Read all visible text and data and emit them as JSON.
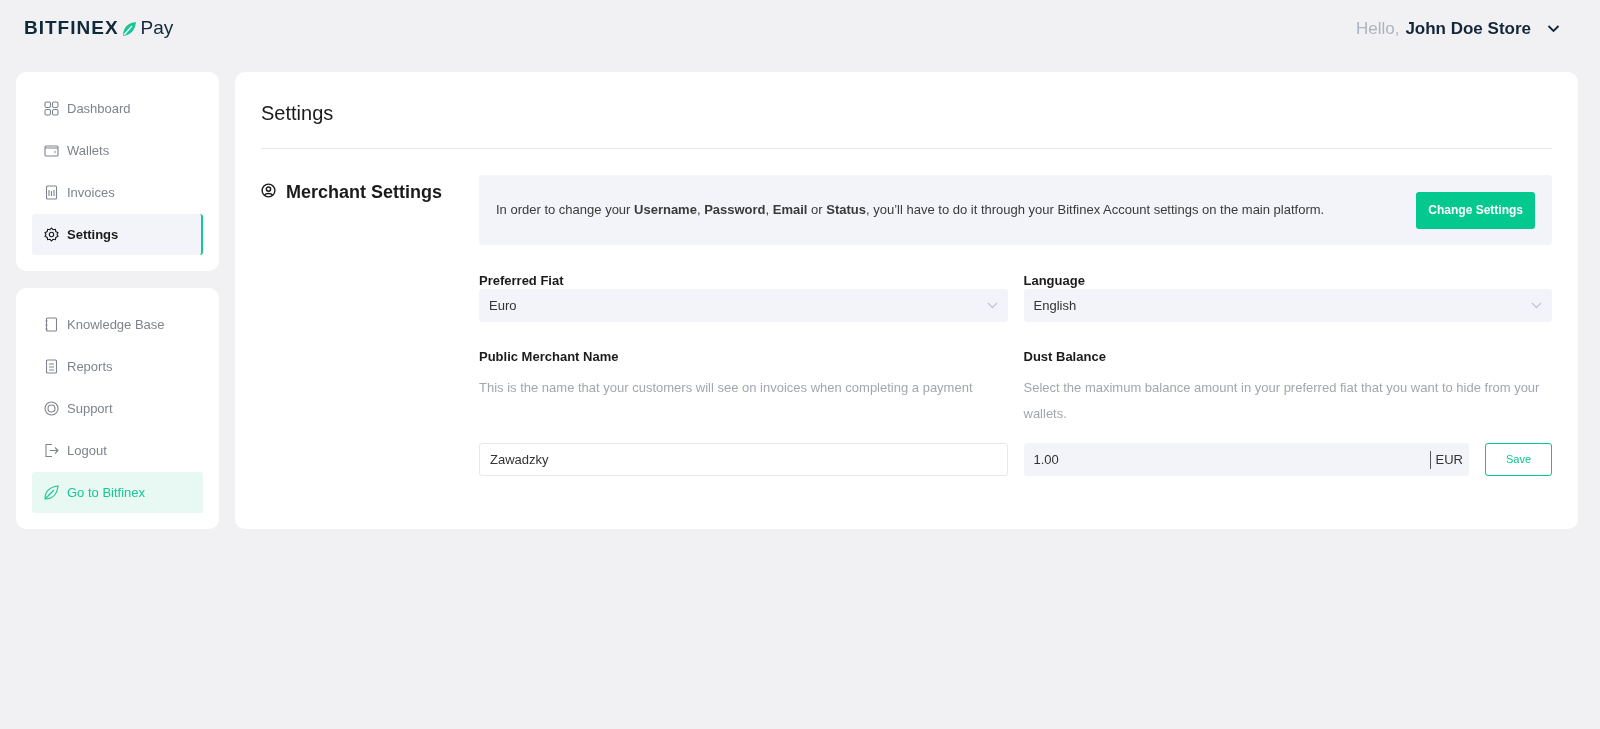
{
  "header": {
    "logo": {
      "brand": "BITFINEX",
      "product": "Pay"
    },
    "greeting": "Hello,",
    "user_name": "John Doe Store"
  },
  "sidebar": {
    "main_items": [
      {
        "label": "Dashboard",
        "selected": false
      },
      {
        "label": "Wallets",
        "selected": false
      },
      {
        "label": "Invoices",
        "selected": false
      },
      {
        "label": "Settings",
        "selected": true
      }
    ],
    "secondary_items": [
      {
        "label": "Knowledge Base",
        "kind": "link"
      },
      {
        "label": "Reports",
        "kind": "link"
      },
      {
        "label": "Support",
        "kind": "link"
      },
      {
        "label": "Logout",
        "kind": "link"
      },
      {
        "label": "Go to Bitfinex",
        "kind": "highlight"
      }
    ]
  },
  "page": {
    "title": "Settings",
    "section_title": "Merchant Settings",
    "notice": {
      "text": "In order to change your **Username**, **Password**, **Email** or **Status**, you’ll have to do it through your Bitfinex Account settings on the main platform.",
      "button": "Change Settings"
    },
    "preferred_fiat": {
      "label": "Preferred Fiat",
      "value": "Euro"
    },
    "language": {
      "label": "Language",
      "value": "English"
    },
    "public_merchant_name": {
      "label": "Public Merchant Name",
      "description": "This is the name that your customers will see on invoices when completing a payment",
      "value": "Zawadzky"
    },
    "dust_balance": {
      "label": "Dust Balance",
      "description": "Select the maximum balance amount in your preferred fiat that you want to hide from your wallets.",
      "value": "1.00",
      "unit": "EUR",
      "button": "Save"
    }
  }
}
